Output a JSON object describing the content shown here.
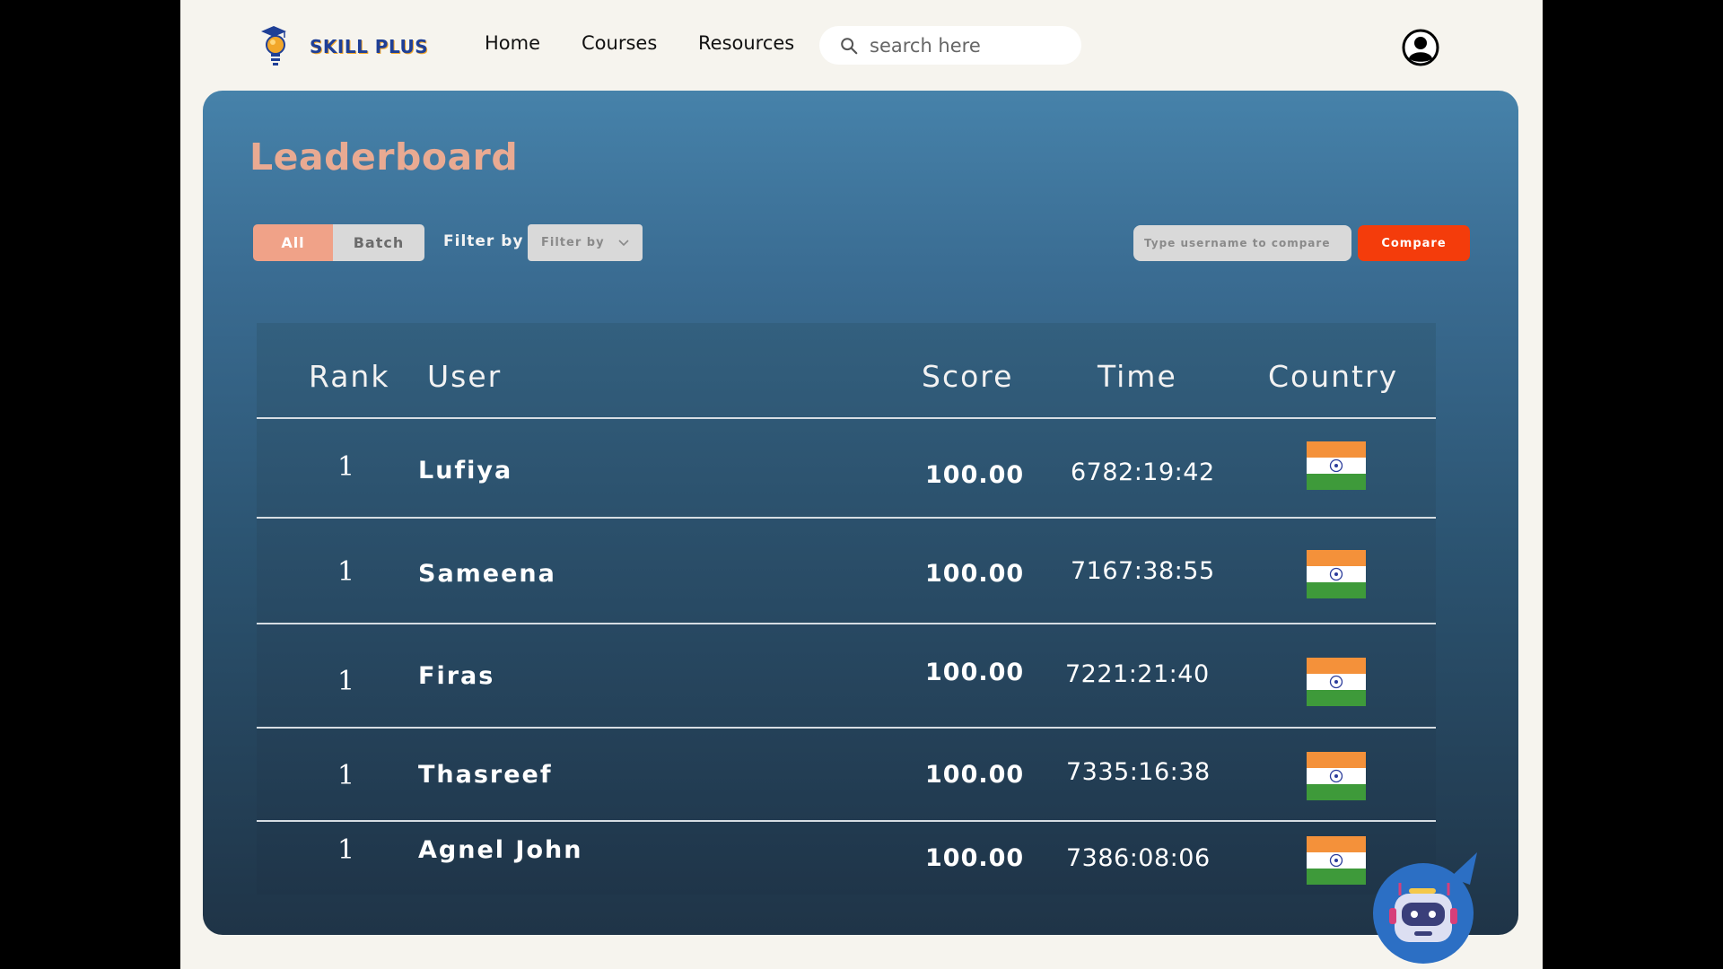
{
  "brand": {
    "name": "SKILL PLUS"
  },
  "nav": [
    {
      "label": "Home"
    },
    {
      "label": "Courses"
    },
    {
      "label": "Resources"
    }
  ],
  "search": {
    "placeholder": "search here"
  },
  "page": {
    "title": "Leaderboard",
    "toggle": {
      "all": "All",
      "batch": "Batch",
      "selected": "All"
    },
    "filter_label": "Filter by",
    "filter_select": {
      "value": "Filter by"
    },
    "compare": {
      "placeholder": "Type username to compare",
      "button": "Compare"
    }
  },
  "table": {
    "headers": {
      "rank": "Rank",
      "user": "User",
      "score": "Score",
      "time": "Time",
      "country": "Country"
    },
    "rows": [
      {
        "rank": "1",
        "user": "Lufiya",
        "score": "100.00",
        "time": "6782:19:42",
        "country": "India"
      },
      {
        "rank": "1",
        "user": "Sameena",
        "score": "100.00",
        "time": "7167:38:55",
        "country": "India"
      },
      {
        "rank": "1",
        "user": "Firas",
        "score": "100.00",
        "time": "7221:21:40",
        "country": "India"
      },
      {
        "rank": "1",
        "user": "Thasreef",
        "score": "100.00",
        "time": "7335:16:38",
        "country": "India"
      },
      {
        "rank": "1",
        "user": "Agnel John",
        "score": "100.00",
        "time": "7386:08:06",
        "country": "India"
      }
    ]
  },
  "colors": {
    "page_bg": "#f6f4ee",
    "panel_top": "#4682aa",
    "panel_bottom": "#1f3447",
    "title": "#e9aa92",
    "toggle_active": "#f0a288",
    "compare_button": "#f43c0b",
    "brand_text": "#1f3f96"
  },
  "icons": {
    "logo": "bulb-graduation-cap-icon",
    "search": "search-icon",
    "profile": "user-circle-icon",
    "filter": "chevron-down-icon",
    "flag": "india-flag-icon",
    "assistant": "robot-chat-icon"
  }
}
